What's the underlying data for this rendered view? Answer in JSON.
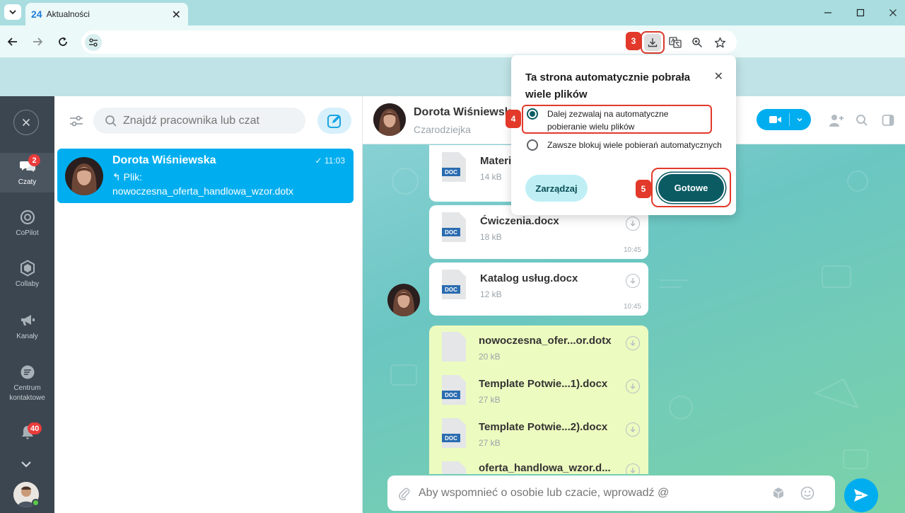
{
  "browser": {
    "tab_logo": "24",
    "tab_title": "Aktualności",
    "tab_close": "✕",
    "window_buttons": {
      "minimize": "—",
      "maximize": "☐",
      "close": "✕"
    }
  },
  "steps": {
    "s3": "3",
    "s4": "4",
    "s5": "5"
  },
  "popup": {
    "title": "Ta strona automatycznie pobrała wiele plików",
    "close": "✕",
    "option_allow": "Dalej zezwalaj na automatyczne pobieranie wielu plików",
    "option_block": "Zawsze blokuj wiele pobierań automatycznych",
    "selected": "option_allow",
    "manage_label": "Zarządzaj",
    "done_label": "Gotowe"
  },
  "leftnav": {
    "items": [
      {
        "label": "Czaty",
        "badge": "2"
      },
      {
        "label": "CoPilot"
      },
      {
        "label": "Collaby"
      },
      {
        "label": "Kanały"
      },
      {
        "label": "Centrum kontaktowe"
      },
      {
        "label": "",
        "badge": "40"
      }
    ]
  },
  "chatlist": {
    "search_placeholder": "Znajdź pracownika lub czat",
    "item": {
      "name": "Dorota Wiśniewska",
      "time": "✓ 11:03",
      "preview_line1": "↰ Plik:",
      "preview_line2": "nowoczesna_oferta_handlowa_wzor.dotx"
    }
  },
  "chat": {
    "header_name": "Dorota Wiśniewska",
    "header_subtitle": "Czarodziejka",
    "files": [
      {
        "name": "Materi",
        "size": "14 kB",
        "time": ""
      },
      {
        "name": "Ćwiczenia.docx",
        "size": "18 kB",
        "time": "10:45"
      },
      {
        "name": "Katalog usług.docx",
        "size": "12 kB",
        "time": "10:45"
      }
    ],
    "own_files": [
      {
        "name": "nowoczesna_ofer...or.dotx",
        "size": "20 kB",
        "doc": false
      },
      {
        "name": "Template Potwie...1).docx",
        "size": "27 kB",
        "doc": true
      },
      {
        "name": "Template Potwie...2).docx",
        "size": "27 kB",
        "doc": true
      },
      {
        "name": "oferta_handlowa_wzor.d...",
        "size": "",
        "doc": true
      }
    ],
    "doc_tag": "DOC",
    "input_placeholder": "Aby wspomnieć o osobie lub czacie, wprowadź @"
  },
  "colors": {
    "accent": "#00aeef",
    "done": "#0b5b63",
    "step": "#e2392a"
  }
}
